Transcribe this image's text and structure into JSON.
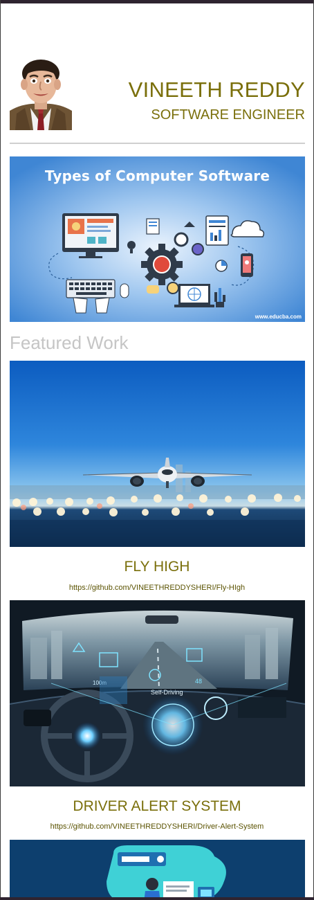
{
  "header": {
    "name": "VINEETH REDDY",
    "role": "SOFTWARE ENGINEER",
    "avatar_icon": "person-portrait-icon"
  },
  "banner": {
    "title": "Types of Computer Software",
    "credit": "www.educba.com",
    "bg_color": "#4a8fd8"
  },
  "featured": {
    "heading": "Featured Work",
    "projects": [
      {
        "title": "FLY HIGH",
        "link": "https://github.com/VINEETHREDDYSHERI/Fly-HIgh"
      },
      {
        "title": "DRIVER ALERT SYSTEM",
        "link": "https://github.com/VINEETHREDDYSHERI/Driver-Alert-System"
      }
    ]
  },
  "colors": {
    "accent": "#7a6f0b",
    "link": "#5a5200",
    "heading_muted": "#c5c5c5",
    "frame": "#2f2430"
  }
}
